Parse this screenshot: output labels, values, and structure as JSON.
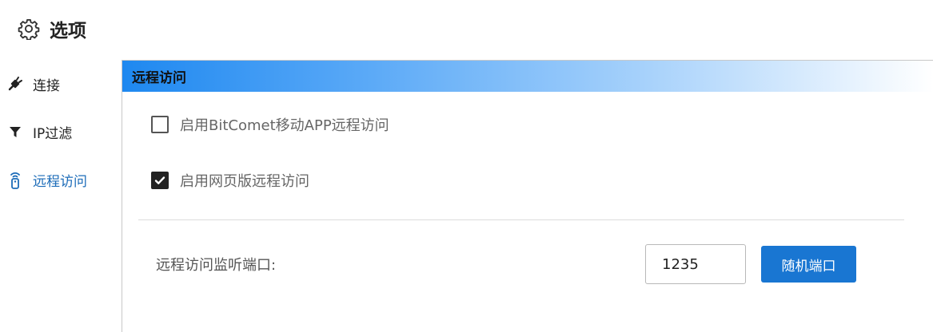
{
  "header": {
    "title": "选项",
    "icon": "gear-icon"
  },
  "sidebar": {
    "items": [
      {
        "label": "连接",
        "icon": "plug-icon"
      },
      {
        "label": "IP过滤",
        "icon": "filter-icon"
      },
      {
        "label": "远程访问",
        "icon": "remote-icon",
        "active": true
      }
    ]
  },
  "panel": {
    "title": "远程访问",
    "options": [
      {
        "label": "启用BitComet移动APP远程访问",
        "checked": false
      },
      {
        "label": "启用网页版远程访问",
        "checked": true
      }
    ],
    "port": {
      "label": "远程访问监听端口:",
      "value": "1235",
      "button_label": "随机端口"
    }
  },
  "colors": {
    "accent": "#1976d2",
    "active_text": "#1b6bb8"
  }
}
